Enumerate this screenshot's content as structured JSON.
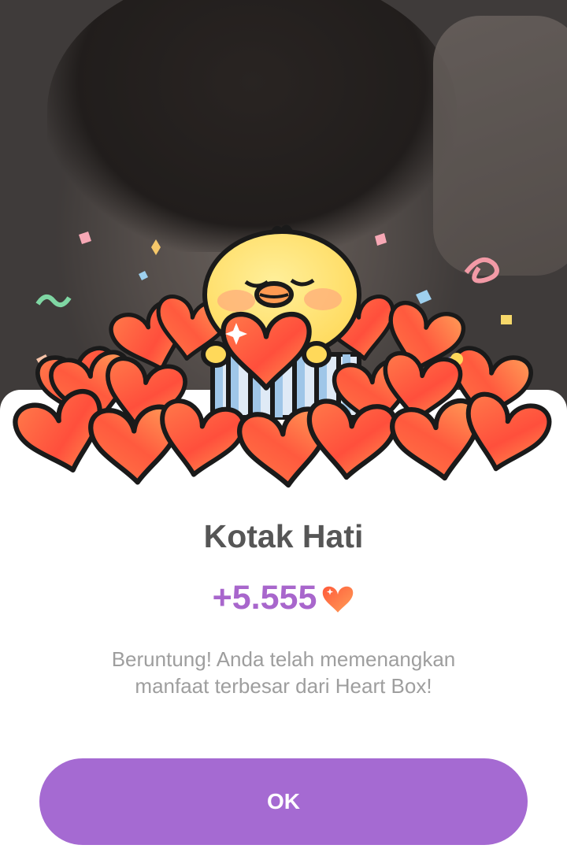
{
  "dialog": {
    "title": "Kotak Hati",
    "reward_amount": "+5.555",
    "reward_icon": "heart-icon",
    "message": "Beruntung! Anda telah memenangkan manfaat terbesar dari Heart Box!",
    "ok_label": "OK"
  },
  "colors": {
    "accent": "#a56ad2",
    "amount_text": "#a866cc",
    "heart": "#ff5a3a",
    "title_text": "#565656",
    "body_text": "#9e9e9e"
  }
}
